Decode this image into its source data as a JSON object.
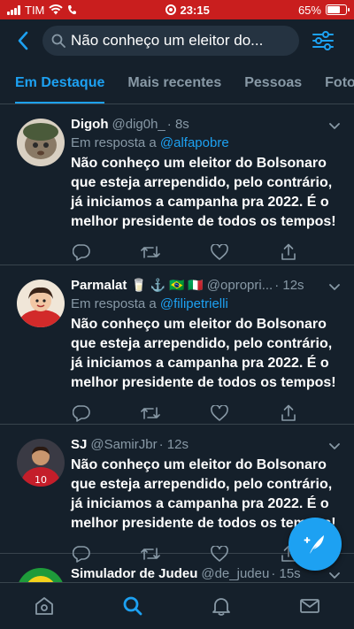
{
  "status_bar": {
    "carrier": "TIM",
    "time": "23:15",
    "battery": "65%",
    "battery_level": 0.65,
    "background_color": "#c91e1e"
  },
  "header": {
    "search_query": "Não conheço um eleitor do...",
    "back_icon": "chevron-left-icon",
    "filter_icon": "sliders-icon"
  },
  "tabs": [
    {
      "label": "Em Destaque",
      "active": true
    },
    {
      "label": "Mais recentes",
      "active": false
    },
    {
      "label": "Pessoas",
      "active": false
    },
    {
      "label": "Fotos",
      "active": false
    }
  ],
  "tweets": [
    {
      "name": "Digoh",
      "handle": "@dig0h_",
      "time": "· 8s",
      "reply_prefix": "Em resposta a",
      "reply_to": "@alfapobre",
      "text": "Não conheço um eleitor do Bolsonaro que esteja arrependido, pelo contrário, já iniciamos a campanha pra 2022. É o melhor presidente de todos os tempos!"
    },
    {
      "name": "Parmalat",
      "name_emojis": "🥛 ⚓ 🇧🇷 🇮🇹",
      "handle": "@opropri...",
      "time": "· 12s",
      "reply_prefix": "Em resposta a",
      "reply_to": "@filipetrielli",
      "text": "Não conheço um eleitor do Bolsonaro que esteja arrependido, pelo contrário, já iniciamos a campanha pra 2022. É o melhor presidente de todos os tempos!"
    },
    {
      "name": "SJ",
      "handle": "@SamirJbr",
      "time": "· 12s",
      "text": "Não conheço um eleitor do Bolsonaro que esteja arrependido, pelo contrário, já iniciamos a campanha pra 2022. É o melhor presidente de todos os tempos!"
    },
    {
      "name": "Simulador de Judeu",
      "handle": "@de_judeu",
      "time": "· 15s"
    }
  ],
  "fab": {
    "icon": "compose-feather-icon"
  },
  "bottom_nav": [
    {
      "icon": "home-icon",
      "active": false
    },
    {
      "icon": "search-icon",
      "active": true
    },
    {
      "icon": "bell-icon",
      "active": false
    },
    {
      "icon": "mail-icon",
      "active": false
    }
  ],
  "colors": {
    "background": "#15202b",
    "accent": "#1da1f2",
    "muted": "#8899a6",
    "divider": "#38444d"
  }
}
